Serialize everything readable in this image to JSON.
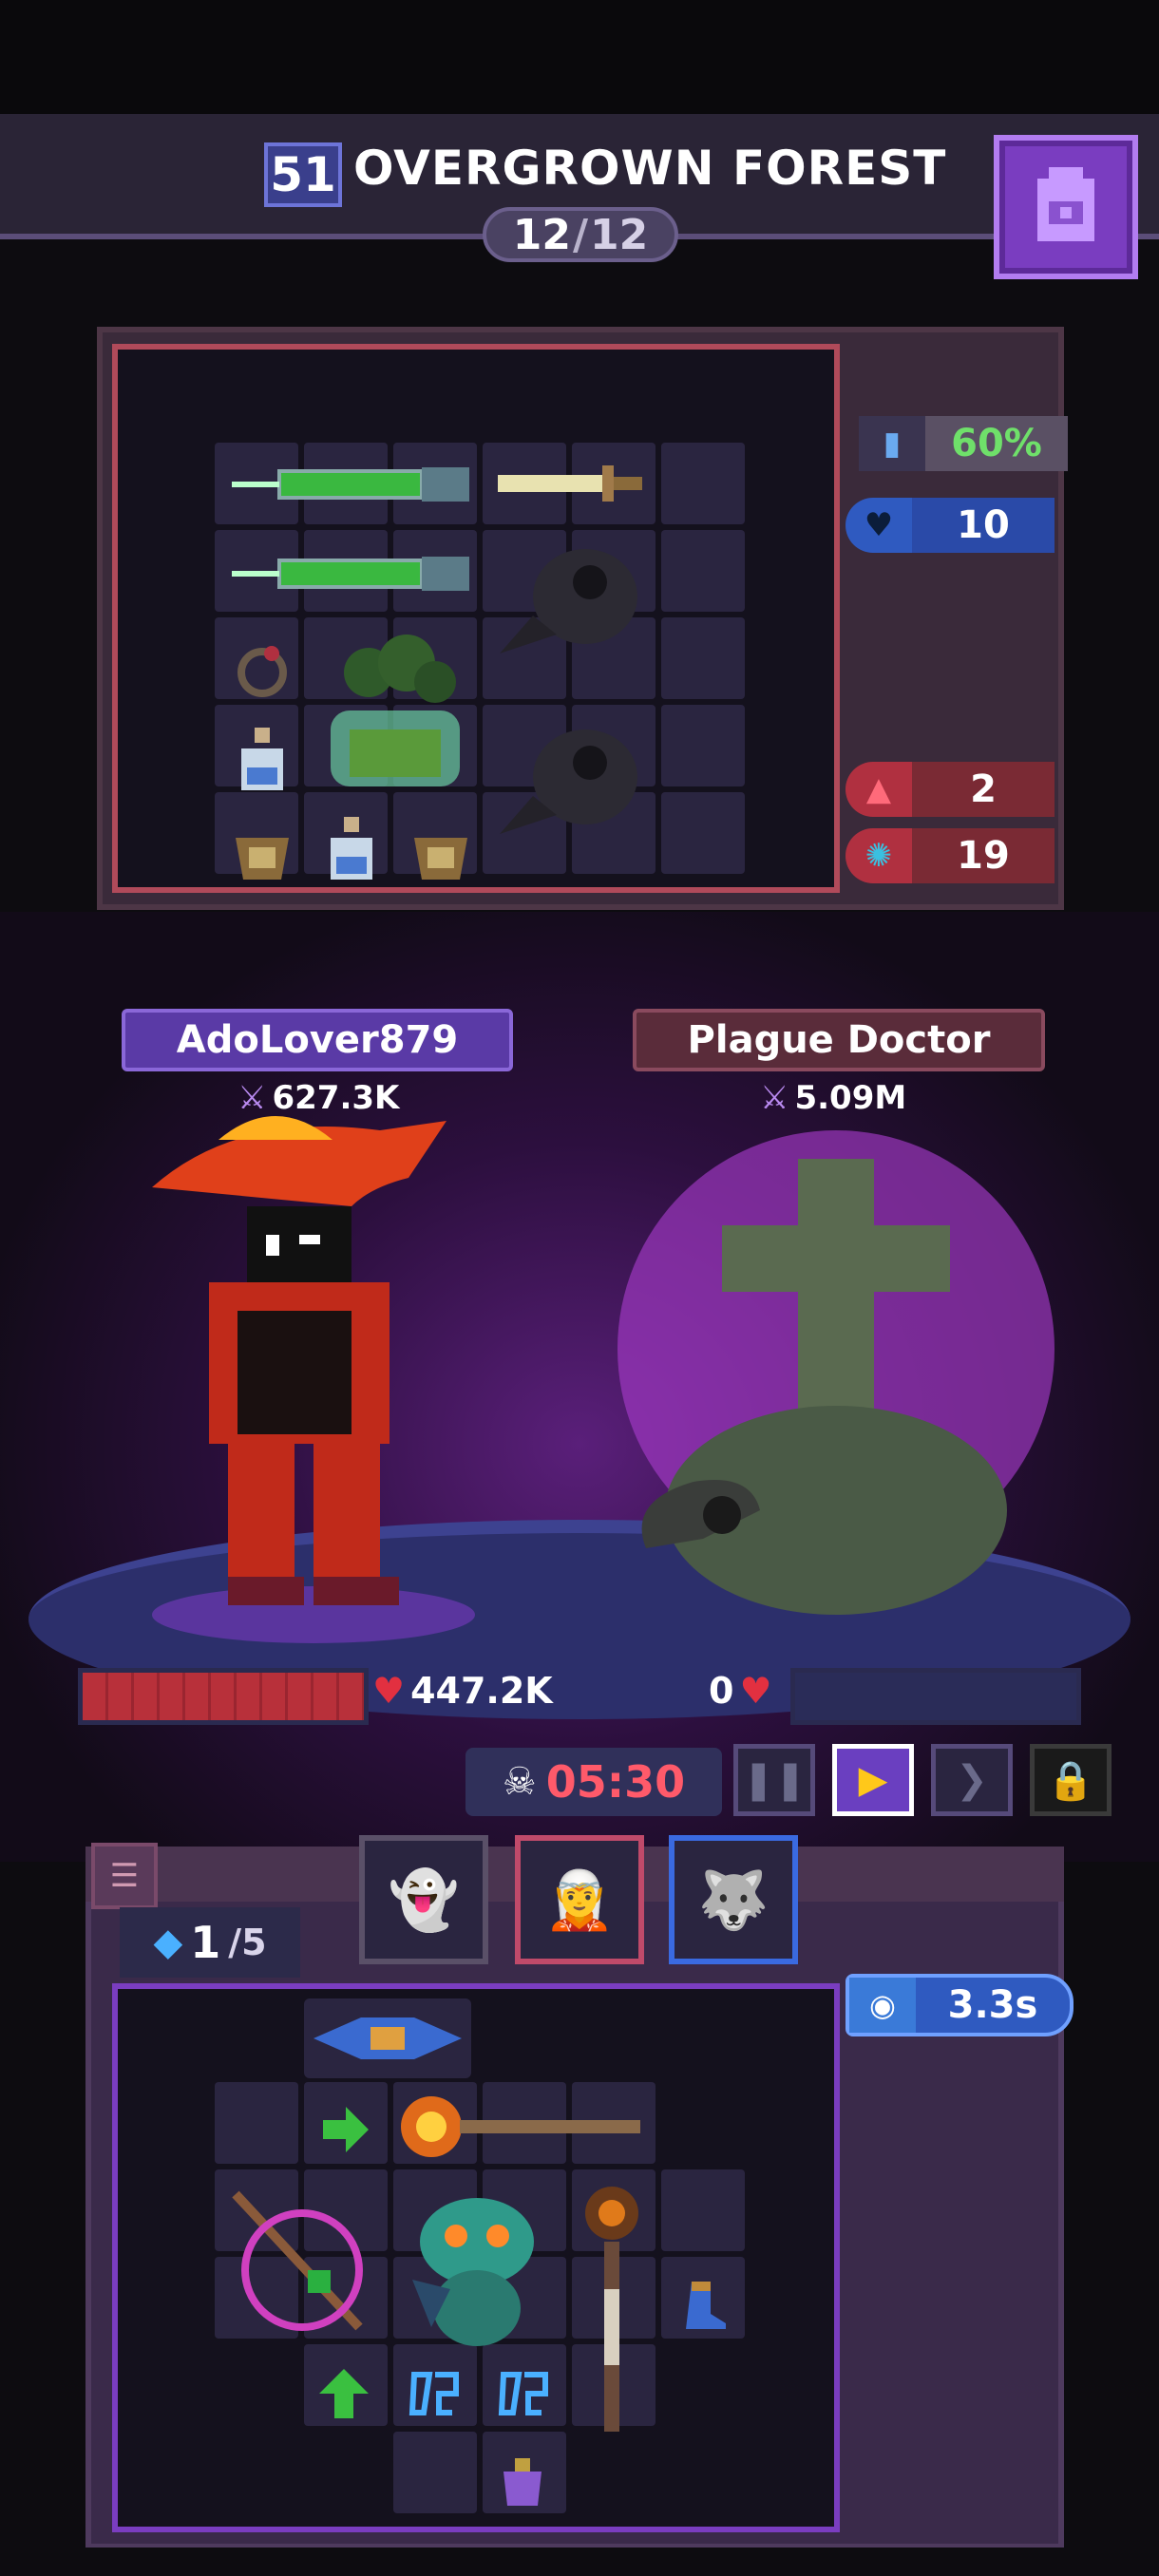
{
  "header": {
    "level": "51",
    "stage_name": "OVERGROWN FOREST",
    "wave_current": "12",
    "wave_total": "12",
    "bag_icon": "backpack-icon"
  },
  "enemy_stats": [
    {
      "icon": "speed-icon",
      "value": "60%",
      "color": "#6fe06a"
    },
    {
      "icon": "heart-shield-icon",
      "value": "10",
      "color": "#ffffff"
    },
    {
      "icon": "fire-icon",
      "value": "2",
      "color": "#ffffff"
    },
    {
      "icon": "gear-icon",
      "value": "19",
      "color": "#ffffff"
    }
  ],
  "player": {
    "name": "AdoLover879",
    "power": "627.3K",
    "hp": "447.2K",
    "hp_fraction": 1.0
  },
  "enemy": {
    "name": "Plague Doctor",
    "power": "5.09M",
    "hp": "0",
    "hp_fraction": 0.0
  },
  "battle": {
    "timer": "05:30",
    "controls": [
      "pause-icon",
      "play-icon",
      "fast-forward-icon",
      "lock-icon"
    ]
  },
  "team": {
    "gems_current": "1",
    "gems_max": "/5",
    "portraits": [
      "ghost-cat-portrait",
      "blue-girl-portrait",
      "wolf-portrait"
    ],
    "cooldown": "3.3s"
  },
  "colors": {
    "accent_purple": "#7a3dc0",
    "hp_red": "#b8303a",
    "timer_red": "#ff5a6a",
    "cooldown_blue": "#2f5ac0"
  }
}
